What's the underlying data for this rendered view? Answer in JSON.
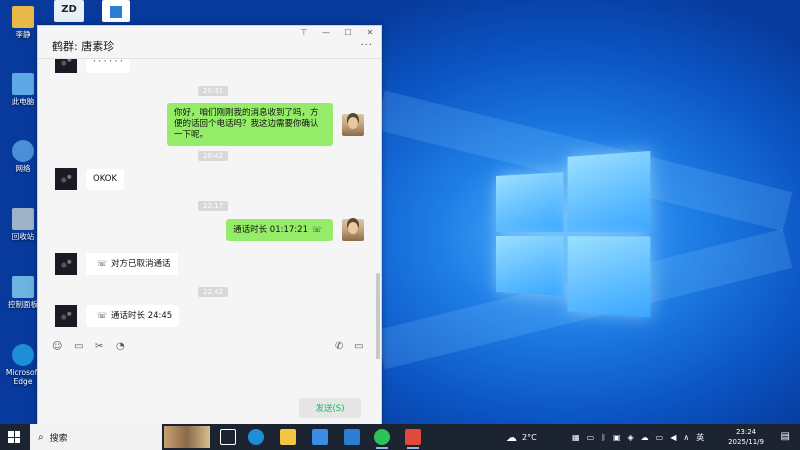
{
  "desktop": {
    "icons": [
      {
        "label": "李静",
        "color": "#e8b84a"
      },
      {
        "label": "此电脑",
        "color": "#5fa8e8"
      },
      {
        "label": "网络",
        "color": "#4a90d9"
      },
      {
        "label": "回收站",
        "color": "#9fb3c8"
      },
      {
        "label": "控制面板",
        "color": "#6bb3e0"
      },
      {
        "label": "Microsoft Edge",
        "color": "#1e8fd6"
      }
    ],
    "top_icons": [
      {
        "name": "ZD",
        "color": "#e8f0f8"
      },
      {
        "name": "app",
        "color": "#ffffff"
      }
    ]
  },
  "chat": {
    "title": "鹤群: 唐素珍",
    "more_icon": "more-icon",
    "window_controls": {
      "pin": "⊤",
      "minimize": "—",
      "maximize": "☐",
      "close": "✕"
    },
    "messages": [
      {
        "type": "in",
        "text": "OKOK (cropped)",
        "display": "· · · · · ·"
      },
      {
        "type": "time",
        "text": "20:31"
      },
      {
        "type": "out",
        "text": "你好，咱们刚刚我的消息收到了吗，方便的话回个电话吗？我这边需要你确认一下呢。"
      },
      {
        "type": "time",
        "text": "20:42"
      },
      {
        "type": "in",
        "text": "OKOK"
      },
      {
        "type": "time",
        "text": "22:17"
      },
      {
        "type": "out",
        "text": "通话时长 01:17:21",
        "call": true
      },
      {
        "type": "in",
        "text": "对方已取消通话",
        "call": true
      },
      {
        "type": "time",
        "text": "22:42"
      },
      {
        "type": "in",
        "text": "通话时长 24:45",
        "call": true
      }
    ],
    "toolbar": {
      "emoji": "☺",
      "file": "▭",
      "screenshot": "✂",
      "history": "◔",
      "voice_call": "✆",
      "video_call": "▭"
    },
    "send_label": "发送(S)"
  },
  "taskbar": {
    "search_placeholder": "搜索",
    "weather": "2°C",
    "ime": "英",
    "time": "23:24",
    "date": "2025/11/9",
    "apps": [
      {
        "name": "task-view",
        "color": "#ffffff"
      },
      {
        "name": "edge",
        "color": "#1e8fd6"
      },
      {
        "name": "file-explorer",
        "color": "#f4c542"
      },
      {
        "name": "store",
        "color": "#3a8ee6"
      },
      {
        "name": "mail",
        "color": "#2a7fd4"
      },
      {
        "name": "wechat",
        "color": "#2ec35a"
      },
      {
        "name": "app-red",
        "color": "#e04a3a"
      }
    ]
  }
}
